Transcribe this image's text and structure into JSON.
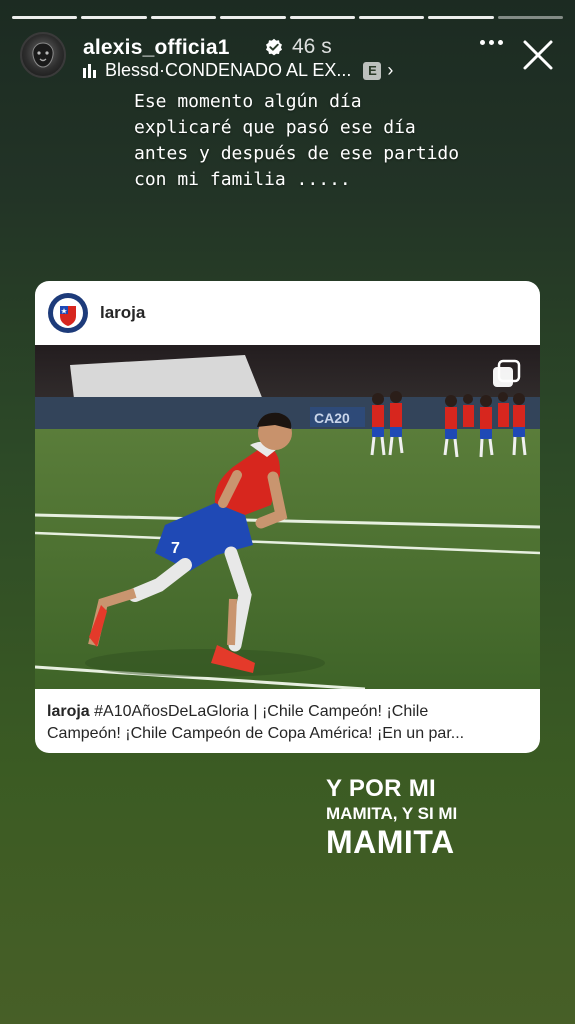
{
  "story": {
    "progress_segments": 8,
    "progress_done": 7
  },
  "header": {
    "username": "alexis_officia1",
    "time": "46 s",
    "music_artist": "Blessd",
    "music_separator": " · ",
    "music_title": "CONDENADO AL EX...",
    "explicit_badge": "E",
    "chevron": "›"
  },
  "caption": {
    "text": "Ese momento algún día\nexplicaré que pasó ese día\nantes y después de ese partido\ncon mi familia ....."
  },
  "shared_post": {
    "username": "laroja",
    "caption_user": "laroja",
    "caption_line1": " #A10AñosDeLaGloria | ¡Chile Campeón! ¡Chile",
    "caption_line2": "Campeón! ¡Chile Campeón de Copa América! ¡En un par...",
    "photo_banner": "CA20"
  },
  "sticker": {
    "line1": "Y POR MI",
    "line2": "MAMITA, Y SI MI",
    "line3": "MAMITA"
  },
  "colors": {
    "accent_red": "#d7261e",
    "shorts_blue": "#1f49b5"
  }
}
